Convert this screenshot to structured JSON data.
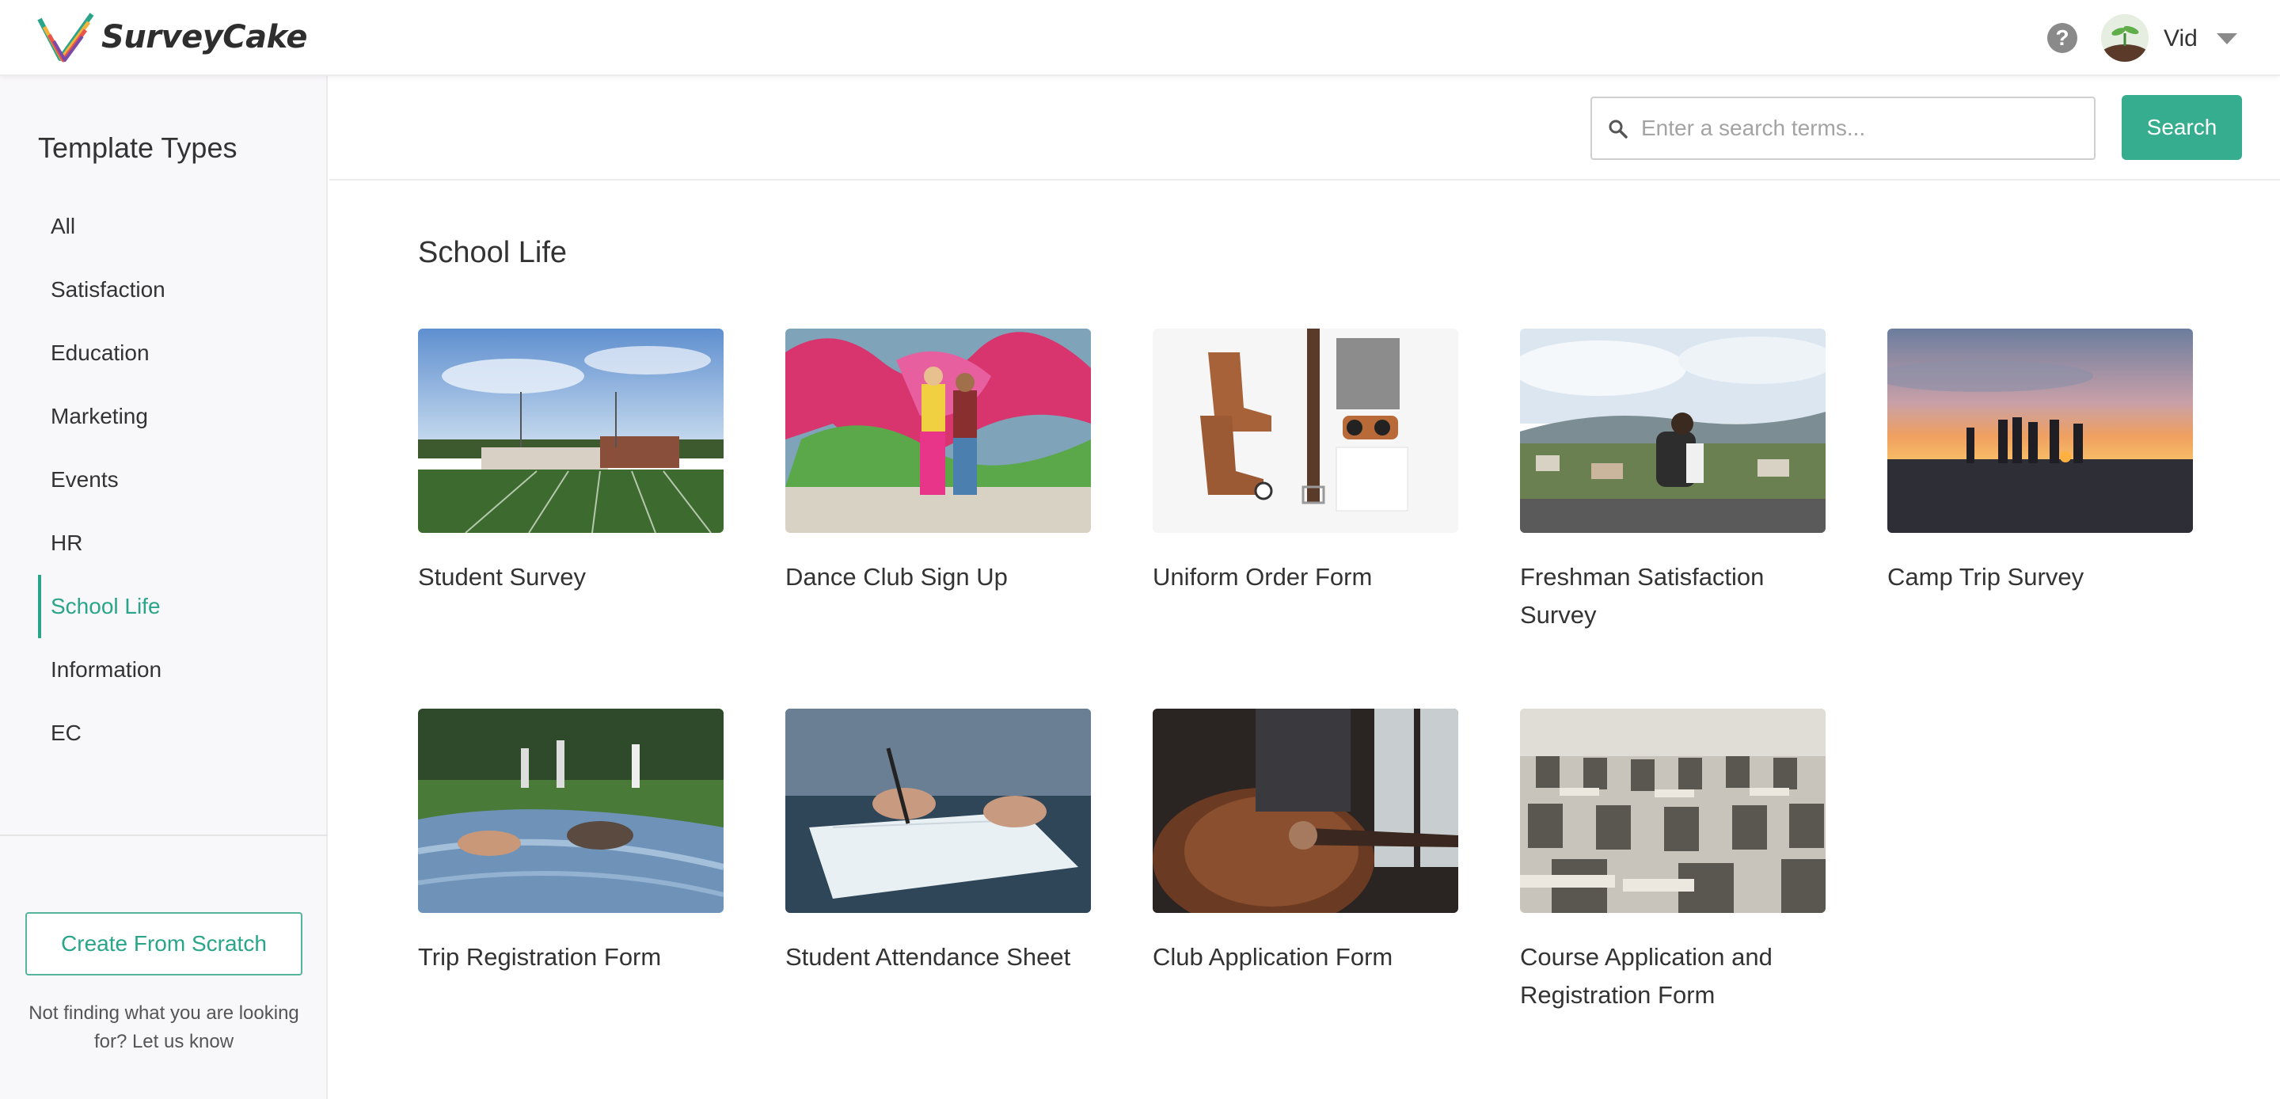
{
  "header": {
    "brand": "SurveyCake",
    "user_name": "Vid",
    "help_symbol": "?"
  },
  "search": {
    "placeholder": "Enter a search terms...",
    "button_label": "Search"
  },
  "sidebar": {
    "title": "Template Types",
    "items": [
      {
        "label": "All",
        "active": false
      },
      {
        "label": "Satisfaction",
        "active": false
      },
      {
        "label": "Education",
        "active": false
      },
      {
        "label": "Marketing",
        "active": false
      },
      {
        "label": "Events",
        "active": false
      },
      {
        "label": "HR",
        "active": false
      },
      {
        "label": "School Life",
        "active": true
      },
      {
        "label": "Information",
        "active": false
      },
      {
        "label": "EC",
        "active": false
      }
    ],
    "create_button": "Create From Scratch",
    "help_text": "Not finding what you are looking for? Let us know"
  },
  "main": {
    "section_title": "School Life",
    "templates": [
      {
        "title": "Student Survey"
      },
      {
        "title": "Dance Club Sign Up"
      },
      {
        "title": "Uniform Order Form"
      },
      {
        "title": "Freshman Satisfaction Survey"
      },
      {
        "title": "Camp Trip Survey"
      },
      {
        "title": "Trip Registration Form"
      },
      {
        "title": "Student Attendance Sheet"
      },
      {
        "title": "Club Application Form"
      },
      {
        "title": "Course Application and Registration Form"
      }
    ]
  },
  "colors": {
    "accent": "#2aa58a",
    "button": "#35ad8e"
  }
}
